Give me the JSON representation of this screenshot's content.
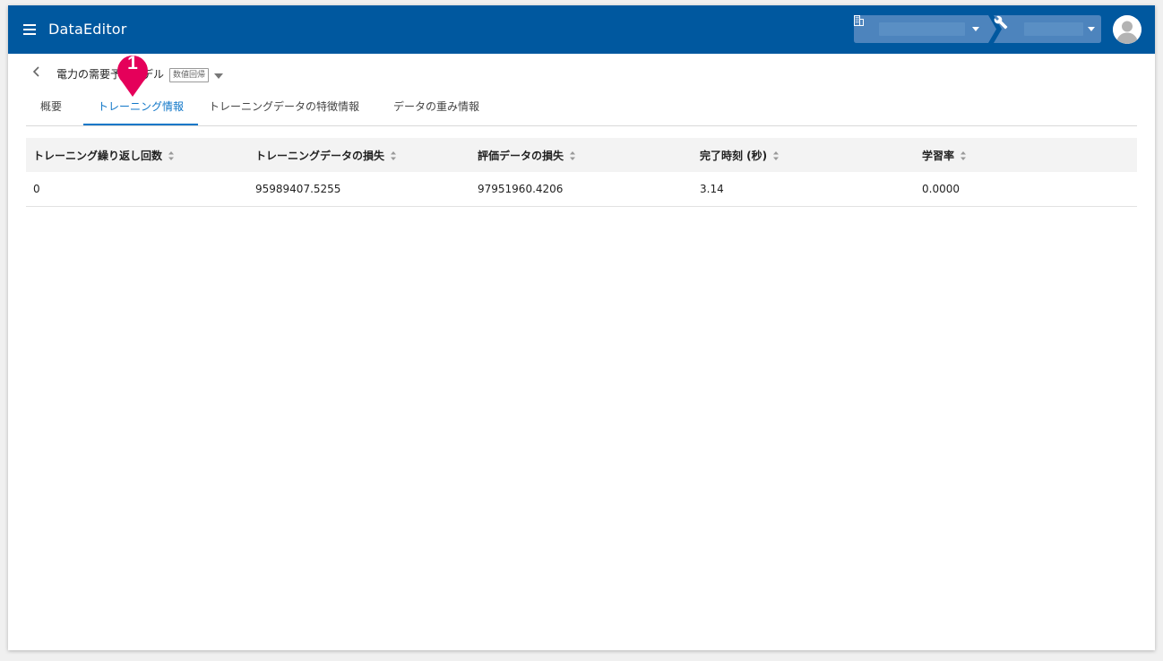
{
  "header": {
    "app_title": "DataEditor",
    "org_selector": {
      "icon": "building-icon",
      "value": ""
    },
    "tool_selector": {
      "icon": "wrench-icon",
      "value": ""
    },
    "colors": {
      "bar": "#00589f",
      "selector": "#4d84bd"
    }
  },
  "breadcrumb": {
    "model_name": "電力の需要予測モデル",
    "badge": "数値回帰"
  },
  "callout": {
    "label": "1",
    "color": "#e5005a"
  },
  "tabs": [
    {
      "label": "概要",
      "active": false
    },
    {
      "label": "トレーニング情報",
      "active": true
    },
    {
      "label": "トレーニングデータの特徴情報",
      "active": false
    },
    {
      "label": "データの重み情報",
      "active": false
    }
  ],
  "table": {
    "columns": [
      "トレーニング繰り返し回数",
      "トレーニングデータの損失",
      "評価データの損失",
      "完了時刻 (秒)",
      "学習率"
    ],
    "rows": [
      [
        "0",
        "95989407.5255",
        "97951960.4206",
        "3.14",
        "0.0000"
      ]
    ]
  }
}
